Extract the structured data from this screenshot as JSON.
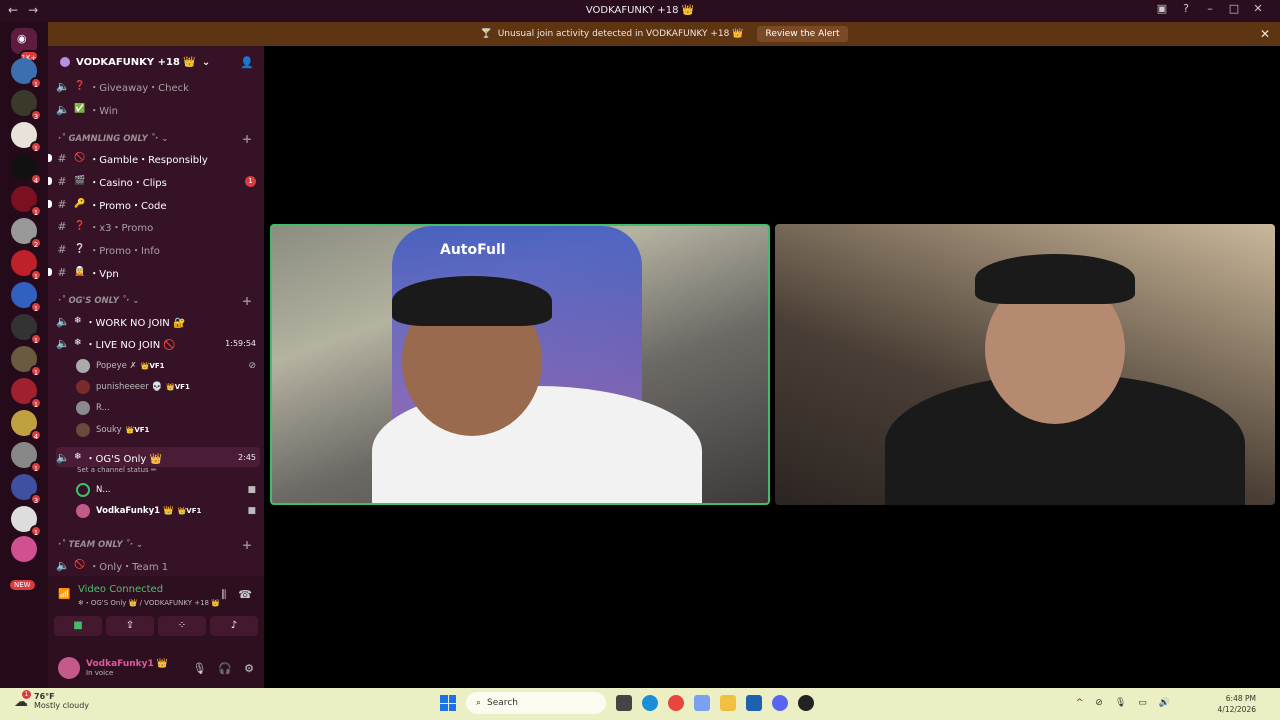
{
  "titlebar": {
    "title": "VODKAFUNKY +18 👑"
  },
  "alert": {
    "text": "Unusual join activity detected in VODKAFUNKY +18 👑",
    "button": "Review the Alert"
  },
  "servers": {
    "home_badge": "1K+",
    "new_label": "NEW"
  },
  "guild": {
    "name": "VODKAFUNKY +18 👑"
  },
  "channels": {
    "giveaway": {
      "emoji": "❓",
      "label": "・Giveaway・Check"
    },
    "win": {
      "emoji": "✅",
      "label": "・Win"
    },
    "cat_gambling": "·˚ GAMNLING ONLY ˚·",
    "gamble": {
      "emoji": "🚫",
      "label": "・Gamble・Responsibly"
    },
    "casino": {
      "emoji": "🎬",
      "label": "・Casino・Clips",
      "badge": "1"
    },
    "promo_code": {
      "emoji": "🔑",
      "label": "・Promo・Code"
    },
    "x3": {
      "emoji": "❓",
      "label": "・x3・Promo"
    },
    "promo_info": {
      "emoji": "❔",
      "label": "・Promo・Info"
    },
    "vpn": {
      "emoji": "🧝",
      "label": "・Vpn"
    },
    "cat_ogs": "·˚ OG'S ONLY ˚·",
    "work": {
      "emoji": "❄",
      "label": "・WORK NO JOIN 🔐"
    },
    "live": {
      "emoji": "❄",
      "label": "・LIVE NO JOIN 🚫",
      "timer": "1:59:54"
    },
    "live_users": [
      {
        "name": "Popeye ✗",
        "tag": "👑VF1"
      },
      {
        "name": "punisheeeer 💀",
        "tag": "👑VF1"
      },
      {
        "name": "R...",
        "tag": ""
      },
      {
        "name": "Souky",
        "tag": "👑VF1"
      }
    ],
    "ogs": {
      "emoji": "❄",
      "label": "・OG'S Only 👑",
      "timer": "2:45",
      "status": "Set a channel status ✏"
    },
    "ogs_users": [
      {
        "name": "N...",
        "tag": ""
      },
      {
        "name": "VodkaFunky1 👑",
        "tag": "👑VF1"
      }
    ],
    "cat_team": "·˚ TEAM ONLY ˚·",
    "team": {
      "emoji": "🚫",
      "label": "・Only・Team 1"
    }
  },
  "voice": {
    "status": "Video Connected",
    "sub": "❄・OG'S Only 👑 / VODKAFUNKY +18 👑"
  },
  "user": {
    "name": "VodkaFunky1 👑",
    "status": "In voice"
  },
  "video": {
    "left_chair_text": "AutoFull"
  },
  "taskbar": {
    "temp": "76°F",
    "condition": "Mostly cloudy",
    "search": "Search",
    "time": "6:48 PM",
    "date": "4/12/2026",
    "weather_badge": "1"
  },
  "colors": {
    "accent_green": "#3fbf6a",
    "alert_bg": "#5e3513",
    "unread": "#d83c3e"
  }
}
